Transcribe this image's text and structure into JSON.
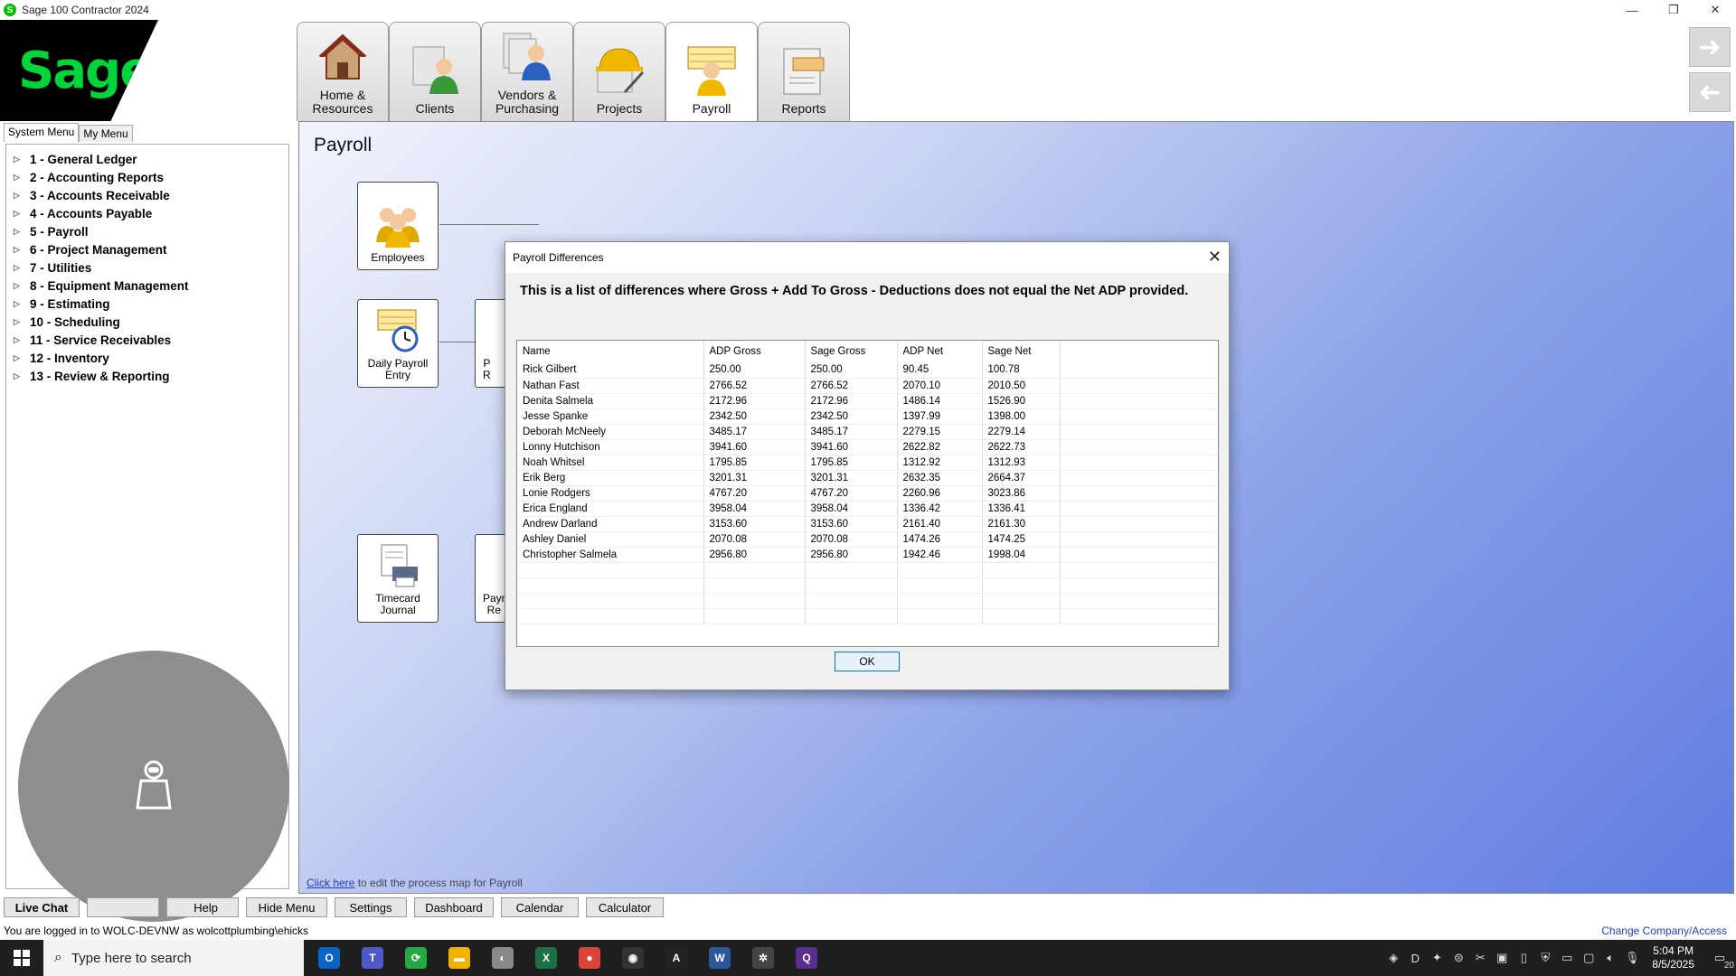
{
  "window": {
    "title": "Sage 100 Contractor 2024",
    "minimize": "—",
    "restore": "❐",
    "close": "✕"
  },
  "logo": {
    "text": "Sage"
  },
  "module_tabs": [
    {
      "label": "Home &\nResources",
      "icon": "house-icon"
    },
    {
      "label": "Clients",
      "icon": "clients-icon"
    },
    {
      "label": "Vendors &\nPurchasing",
      "icon": "vendors-icon"
    },
    {
      "label": "Projects",
      "icon": "hardhat-icon"
    },
    {
      "label": "Payroll",
      "icon": "payroll-icon",
      "active": true
    },
    {
      "label": "Reports",
      "icon": "reports-icon"
    }
  ],
  "menu_tabs": {
    "system": "System Menu",
    "my": "My Menu"
  },
  "menu_items": [
    "1 - General Ledger",
    "2 - Accounting Reports",
    "3 - Accounts Receivable",
    "4 - Accounts Payable",
    "5 - Payroll",
    "6 - Project Management",
    "7 - Utilities",
    "8 - Equipment Management",
    "9 - Estimating",
    "10 - Scheduling",
    "11 - Service Receivables",
    "12 - Inventory",
    "13 - Review & Reporting"
  ],
  "main": {
    "title": "Payroll",
    "boxes": {
      "employees": "Employees",
      "daily": "Daily Payroll\nEntry",
      "timecard": "Timecard\nJournal",
      "partial1": "P\nR",
      "partial2": "Payr\nRe"
    },
    "footer_link": "Click here",
    "footer_text": " to edit the process map for Payroll"
  },
  "bottom_buttons": [
    "Live Chat",
    "",
    "Help",
    "Hide Menu",
    "Settings",
    "Dashboard",
    "Calendar",
    "Calculator"
  ],
  "status": {
    "login": "You are logged in to WOLC-DEVNW as wolcottplumbing\\ehicks",
    "change_company": "Change Company/Access"
  },
  "dialog": {
    "title": "Payroll Differences",
    "message": "This is a list of differences where Gross + Add To Gross - Deductions does not equal the Net ADP provided.",
    "columns": [
      "Name",
      "ADP Gross",
      "Sage Gross",
      "ADP Net",
      "Sage Net"
    ],
    "rows": [
      [
        "Rick Gilbert",
        "250.00",
        "250.00",
        "90.45",
        "100.78"
      ],
      [
        "Nathan Fast",
        "2766.52",
        "2766.52",
        "2070.10",
        "2010.50"
      ],
      [
        "Denita Salmela",
        "2172.96",
        "2172.96",
        "1486.14",
        "1526.90"
      ],
      [
        "Jesse Spanke",
        "2342.50",
        "2342.50",
        "1397.99",
        "1398.00"
      ],
      [
        "Deborah McNeely",
        "3485.17",
        "3485.17",
        "2279.15",
        "2279.14"
      ],
      [
        "Lonny Hutchison",
        "3941.60",
        "3941.60",
        "2622.82",
        "2622.73"
      ],
      [
        "Noah Whitsel",
        "1795.85",
        "1795.85",
        "1312.92",
        "1312.93"
      ],
      [
        "Erik Berg",
        "3201.31",
        "3201.31",
        "2632.35",
        "2664.37"
      ],
      [
        "Lonie Rodgers",
        "4767.20",
        "4767.20",
        "2260.96",
        "3023.86"
      ],
      [
        "Erica England",
        "3958.04",
        "3958.04",
        "1336.42",
        "1336.41"
      ],
      [
        "Andrew Darland",
        "3153.60",
        "3153.60",
        "2161.40",
        "2161.30"
      ],
      [
        "Ashley Daniel",
        "2070.08",
        "2070.08",
        "1474.26",
        "1474.25"
      ],
      [
        "Christopher Salmela",
        "2956.80",
        "2956.80",
        "1942.46",
        "1998.04"
      ]
    ],
    "ok": "OK",
    "close": "✕"
  },
  "taskbar": {
    "search_placeholder": "Type here to search",
    "time": "5:04 PM",
    "date": "8/5/2025",
    "notif_count": "20",
    "apps": [
      {
        "name": "outlook",
        "color": "#0a64c8",
        "glyph": "O"
      },
      {
        "name": "teams",
        "color": "#5059c9",
        "glyph": "T"
      },
      {
        "name": "green-app",
        "color": "#27a845",
        "glyph": "⟳"
      },
      {
        "name": "file-explorer",
        "color": "#f0b400",
        "glyph": "▬"
      },
      {
        "name": "chat-app",
        "color": "#888888",
        "glyph": "◐"
      },
      {
        "name": "excel",
        "color": "#1d7044",
        "glyph": "X"
      },
      {
        "name": "chrome",
        "color": "#db4437",
        "glyph": "●"
      },
      {
        "name": "dark-app",
        "color": "#333333",
        "glyph": "◉"
      },
      {
        "name": "acrobat",
        "color": "#222222",
        "glyph": "A"
      },
      {
        "name": "word",
        "color": "#2b579a",
        "glyph": "W"
      },
      {
        "name": "chatgpt",
        "color": "#444444",
        "glyph": "✲"
      },
      {
        "name": "purple-app",
        "color": "#5b2d8c",
        "glyph": "Q"
      }
    ]
  }
}
